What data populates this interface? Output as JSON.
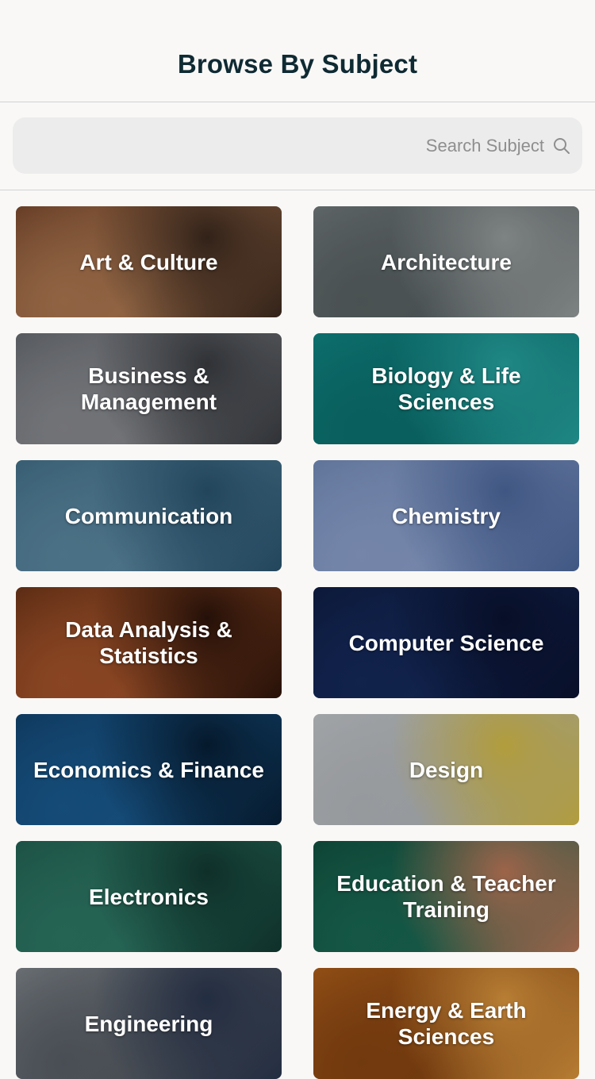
{
  "header": {
    "title": "Browse By Subject"
  },
  "search": {
    "placeholder": "Search Subject"
  },
  "subjects": [
    {
      "label": "Art & Culture",
      "icon": "art-culture-image",
      "colors": [
        "#6b3a22",
        "#b07a52",
        "#3d2a1f"
      ]
    },
    {
      "label": "Architecture",
      "icon": "architecture-image",
      "colors": [
        "#7d8587",
        "#5a6365",
        "#9aa0a0"
      ]
    },
    {
      "label": "Business & Management",
      "icon": "business-image",
      "colors": [
        "#5d6268",
        "#8b8d92",
        "#3a3d42"
      ]
    },
    {
      "label": "Biology & Life Sciences",
      "icon": "biology-image",
      "colors": [
        "#118f8c",
        "#0c7472",
        "#27a6a3"
      ]
    },
    {
      "label": "Communication",
      "icon": "communication-image",
      "colors": [
        "#3c6a84",
        "#5c8aa4",
        "#2a5570"
      ]
    },
    {
      "label": "Chemistry",
      "icon": "chemistry-image",
      "colors": [
        "#6c86b5",
        "#8ea3cf",
        "#4e6aa0"
      ]
    },
    {
      "label": "Data Analysis & Statistics",
      "icon": "data-analysis-image",
      "colors": [
        "#5a2a12",
        "#a8552b",
        "#2d140a"
      ]
    },
    {
      "label": "Computer Science",
      "icon": "computer-science-image",
      "colors": [
        "#0e1a3d",
        "#152a5c",
        "#0a1230"
      ]
    },
    {
      "label": "Economics & Finance",
      "icon": "economics-image",
      "colors": [
        "#0f3d66",
        "#1a5c92",
        "#071f36"
      ]
    },
    {
      "label": "Design",
      "icon": "design-image",
      "colors": [
        "#c9cdd0",
        "#b8bcc0",
        "#d9c04a"
      ]
    },
    {
      "label": "Electronics",
      "icon": "electronics-image",
      "colors": [
        "#1f5c4e",
        "#2e7a66",
        "#123a32"
      ]
    },
    {
      "label": "Education & Teacher Training",
      "icon": "education-image",
      "colors": [
        "#0e4a3a",
        "#1a6a54",
        "#c07a5a"
      ]
    },
    {
      "label": "Engineering",
      "icon": "engineering-image",
      "colors": [
        "#8f959a",
        "#5a6068",
        "#2c3850"
      ]
    },
    {
      "label": "Energy & Earth Sciences",
      "icon": "energy-image",
      "colors": [
        "#c06a1e",
        "#8a4612",
        "#e09a40"
      ]
    }
  ]
}
